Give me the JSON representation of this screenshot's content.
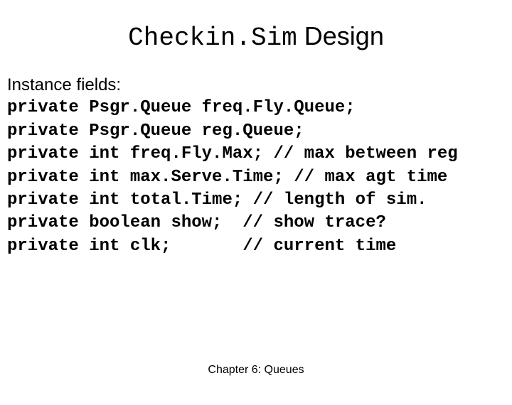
{
  "title": {
    "mono_part": "Checkin.Sim",
    "serif_part": " Design"
  },
  "instance_label": "Instance fields:",
  "code_lines": [
    "private Psgr.Queue freq.Fly.Queue;",
    "private Psgr.Queue reg.Queue;",
    "private int freq.Fly.Max; // max between reg",
    "private int max.Serve.Time; // max agt time",
    "private int total.Time; // length of sim.",
    "private boolean show;  // show trace?",
    "private int clk;       // current time"
  ],
  "footer": "Chapter 6: Queues"
}
